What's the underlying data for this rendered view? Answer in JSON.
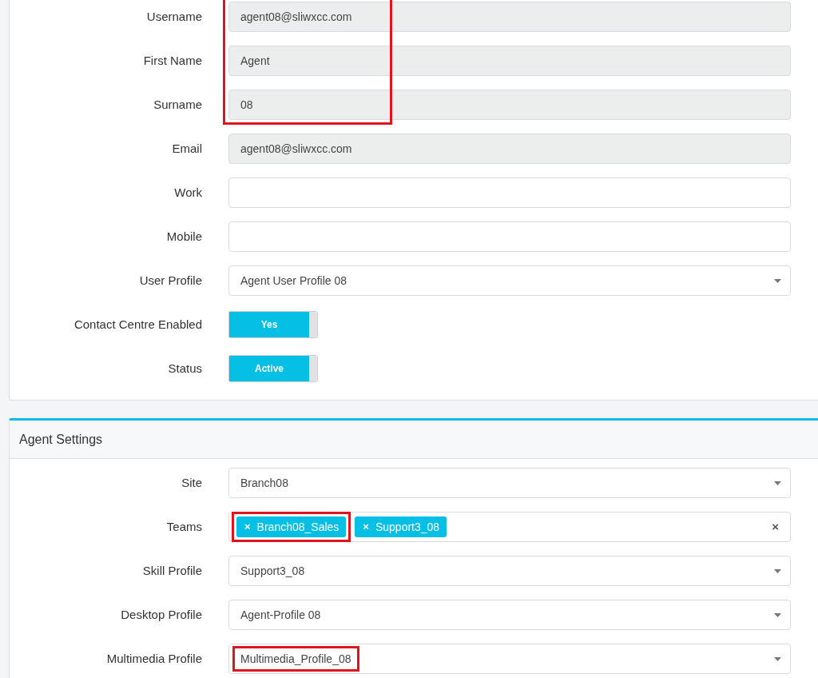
{
  "user_card": {
    "fields": [
      {
        "label": "Username",
        "kind": "text",
        "value": "agent08@sliwxcc.com",
        "disabled": true,
        "highlighted": true
      },
      {
        "label": "First Name",
        "kind": "text",
        "value": "Agent",
        "disabled": true,
        "highlighted": true
      },
      {
        "label": "Surname",
        "kind": "text",
        "value": "08",
        "disabled": true,
        "highlighted": true
      },
      {
        "label": "Email",
        "kind": "text",
        "value": "agent08@sliwxcc.com",
        "disabled": true
      },
      {
        "label": "Work",
        "kind": "text",
        "disabled": false
      },
      {
        "label": "Mobile",
        "kind": "text",
        "disabled": false
      },
      {
        "label": "User Profile",
        "kind": "select",
        "value": "Agent User Profile 08"
      },
      {
        "label": "Contact Centre Enabled",
        "kind": "toggle",
        "value": "Yes",
        "on": true
      },
      {
        "label": "Status",
        "kind": "toggle",
        "value": "Active",
        "on": true
      }
    ]
  },
  "agent_settings": {
    "title": "Agent Settings",
    "fields": [
      {
        "label": "Site",
        "kind": "select",
        "value": "Branch08"
      },
      {
        "label": "Teams",
        "kind": "tags",
        "clear": "×",
        "tags": [
          {
            "remove": "×",
            "text": "Branch08_Sales",
            "highlighted": true
          },
          {
            "remove": "×",
            "text": "Support3_08"
          }
        ]
      },
      {
        "label": "Skill Profile",
        "kind": "select",
        "value": "Support3_08"
      },
      {
        "label": "Desktop Profile",
        "kind": "select",
        "value": "Agent-Profile 08"
      },
      {
        "label": "Multimedia Profile",
        "kind": "select",
        "value": "Multimedia_Profile_08",
        "highlighted": true
      }
    ]
  }
}
